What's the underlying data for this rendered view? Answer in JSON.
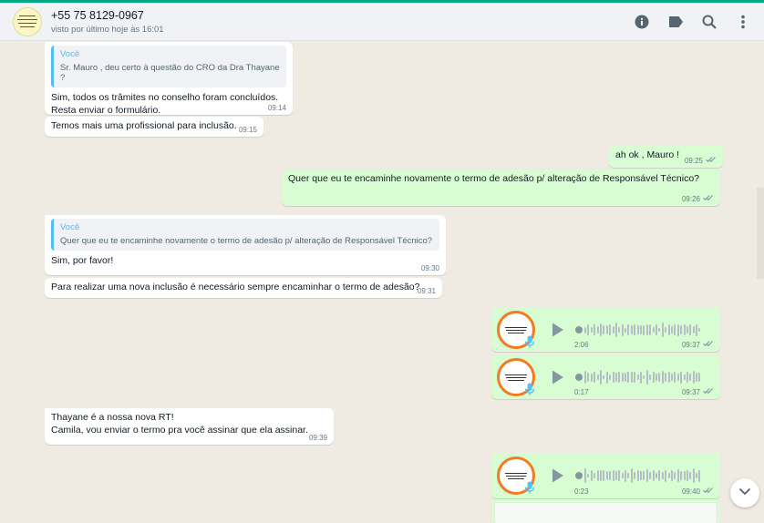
{
  "header": {
    "contact_name": "+55 75 8129-0967",
    "status": "visto por último hoje às 16:01",
    "icons": [
      "info-icon",
      "label-icon",
      "search-icon",
      "menu-icon"
    ]
  },
  "messages": [
    {
      "direction": "in",
      "quote": {
        "author": "Você",
        "text": "Sr. Mauro , deu certo à questão do CRO da Dra Thayane ?"
      },
      "text": "Sim, todos os trâmites no conselho foram concluídos.\nResta enviar o formulário.",
      "time": "09:14"
    },
    {
      "direction": "in",
      "text": "Temos mais uma profissional para inclusão.",
      "time": "09:15"
    },
    {
      "direction": "out",
      "text": "ah ok , Mauro !",
      "time": "09:25"
    },
    {
      "direction": "out",
      "text": "Quer que eu te encaminhe novamente o termo de adesão p/ alteração de Responsável Técnico?",
      "time": "09:26"
    },
    {
      "direction": "in",
      "quote": {
        "author": "Você",
        "text": "Quer que eu te encaminhe novamente o termo de adesão p/ alteração de Responsável Técnico?"
      },
      "text": "Sim, por favor!",
      "time": "09:30"
    },
    {
      "direction": "in",
      "text": "Para realizar uma nova inclusão é necessário sempre encaminhar o termo de adesão?",
      "time": "09:31"
    },
    {
      "direction": "out",
      "type": "audio",
      "duration": "2:06",
      "time": "09:37"
    },
    {
      "direction": "out",
      "type": "audio",
      "duration": "0:17",
      "time": "09:37"
    },
    {
      "direction": "in",
      "text": "Thayane é a nossa nova RT!\nCamila, vou enviar o termo pra você assinar que ela assinar.",
      "time": "09:39"
    },
    {
      "direction": "out",
      "type": "audio",
      "duration": "0:23",
      "time": "09:40"
    }
  ],
  "colors": {
    "accent": "#00a884",
    "outgoing_bubble": "#d9fdd3",
    "incoming_bubble": "#ffffff",
    "read_tick": "#53bdeb",
    "avatar_ring": "#f47b20"
  }
}
